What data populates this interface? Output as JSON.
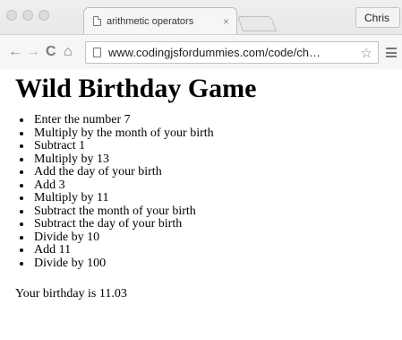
{
  "browser": {
    "tab_title": "arithmetic operators",
    "tab_close": "×",
    "profile_name": "Chris",
    "url": "www.codingjsfordummies.com/code/ch…"
  },
  "page": {
    "heading": "Wild Birthday Game",
    "steps": [
      "Enter the number 7",
      "Multiply by the month of your birth",
      "Subtract 1",
      "Multiply by 13",
      "Add the day of your birth",
      "Add 3",
      "Multiply by 11",
      "Subtract the month of your birth",
      "Subtract the day of your birth",
      "Divide by 10",
      "Add 11",
      "Divide by 100"
    ],
    "result": "Your birthday is 11.03"
  }
}
